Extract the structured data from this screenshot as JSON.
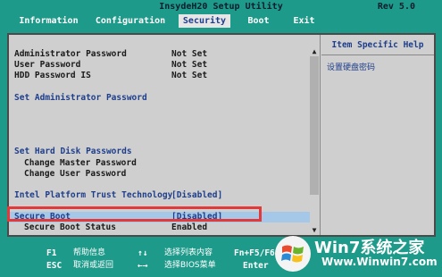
{
  "header": {
    "title": "InsydeH20 Setup Utility",
    "rev": "Rev 5.0",
    "tabs": [
      "Information",
      "Configuration",
      "Security",
      "Boot",
      "Exit"
    ],
    "active_tab": "Security"
  },
  "security": {
    "admin_password_label": "Administrator Password",
    "admin_password_value": "Not Set",
    "user_password_label": "User Password",
    "user_password_value": "Not Set",
    "hdd_password_label": "HDD Password IS",
    "hdd_password_value": "Not Set",
    "set_admin_password": "Set Administrator Password",
    "set_hdd_passwords": "Set Hard Disk Passwords",
    "change_master_password": "Change Master Password",
    "change_user_password": "Change User Password",
    "intel_ptt_label": "Intel Platform Trust Technology",
    "intel_ptt_value": "[Disabled]",
    "secure_boot_label": "Secure Boot",
    "secure_boot_value": "[Disabled]",
    "secure_boot_status_label": "Secure Boot Status",
    "secure_boot_status_value": "Enabled"
  },
  "help": {
    "title": "Item Specific Help",
    "text": "设置硬盘密码"
  },
  "footer": {
    "keys": [
      {
        "key": "F1",
        "desc": "帮助信息"
      },
      {
        "key": "ESC",
        "desc": "取消或返回"
      },
      {
        "key": "↑↓",
        "desc": "选择列表内容"
      },
      {
        "key": "←→",
        "desc": "选择BIOS菜单"
      },
      {
        "key": "Fn+F5/F6",
        "desc": ""
      },
      {
        "key": "Enter",
        "desc": ""
      }
    ]
  },
  "watermark": {
    "text1": "Win7系统之家",
    "text2": "Www.Winwin7.com"
  },
  "colors": {
    "background": "#1e9a8a",
    "panel": "#cfcfcf",
    "accent_blue": "#1e3e8c",
    "highlight": "#a6c8e8",
    "annotation_red": "#e23a3a"
  }
}
